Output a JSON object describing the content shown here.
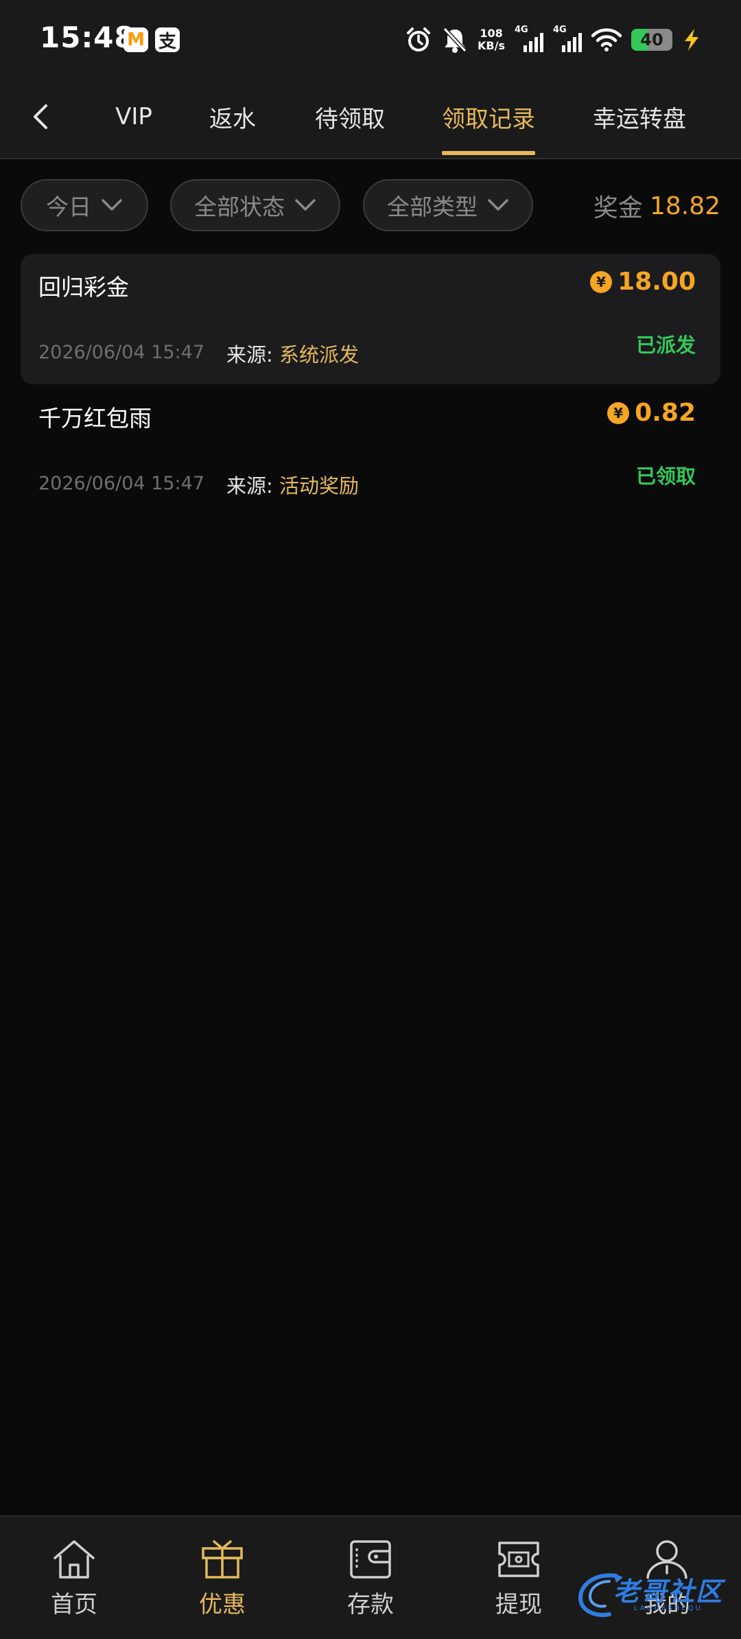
{
  "status_bar": {
    "time": "15:48",
    "app_icon_1": "M",
    "app_icon_2": "支",
    "net_speed_value": "108",
    "net_speed_unit": "KB/s",
    "signal_1_label": "4G",
    "signal_2_label": "4G",
    "battery_level": "40",
    "icons": [
      "alarm-icon",
      "bell-off-icon",
      "wifi-icon",
      "charging-icon"
    ]
  },
  "nav": {
    "back_icon": "chevron-left-icon",
    "tabs": [
      {
        "label": "VIP",
        "active": false
      },
      {
        "label": "返水",
        "active": false
      },
      {
        "label": "待领取",
        "active": false
      },
      {
        "label": "领取记录",
        "active": true
      },
      {
        "label": "幸运转盘",
        "active": false
      }
    ]
  },
  "filters": {
    "date": "今日",
    "status": "全部状态",
    "type": "全部类型",
    "bonus_label": "奖金",
    "bonus_total": "18.82"
  },
  "records": [
    {
      "name": "回归彩金",
      "currency_symbol": "¥",
      "amount": "18.00",
      "time": "2026/06/04 15:47",
      "source_label": "来源:",
      "source_value": "系统派发",
      "status": "已派发"
    },
    {
      "name": "千万红包雨",
      "currency_symbol": "¥",
      "amount": "0.82",
      "time": "2026/06/04 15:47",
      "source_label": "来源:",
      "source_value": "活动奖励",
      "status": "已领取"
    }
  ],
  "bottom_nav": {
    "items": [
      {
        "label": "首页",
        "icon": "home-icon",
        "active": false
      },
      {
        "label": "优惠",
        "icon": "gift-icon",
        "active": true
      },
      {
        "label": "存款",
        "icon": "wallet-icon",
        "active": false
      },
      {
        "label": "提现",
        "icon": "cash-icon",
        "active": false
      },
      {
        "label": "我的",
        "icon": "user-icon",
        "active": false
      }
    ]
  },
  "watermark": {
    "text": "老哥社区",
    "sub": "LAOGESHEQU"
  },
  "colors": {
    "accent": "#e5b95b",
    "amount": "#f5a623",
    "status_green": "#34c759",
    "background": "#0a0a0a",
    "surface": "#1a1a1a"
  }
}
